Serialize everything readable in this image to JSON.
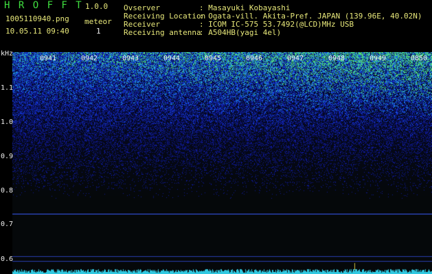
{
  "app": {
    "title": "H R O F F T",
    "version": "1.0.0",
    "filename": "1005110940.png",
    "datetime": "10.05.11 09:40",
    "meteor_label": "meteor",
    "meteor_count": "1"
  },
  "info": {
    "observer_label": "Ovserver",
    "observer_value": ": Masayuki Kobayashi",
    "location_label": "Receiving Location",
    "location_value": ": Ogata-vill. Akita-Pref. JAPAN (139.96E, 40.02N)",
    "receiver_label": "Receiver",
    "receiver_value": ": ICOM IC-575 53.7492(@LCD)MHz USB",
    "antenna_label": "Receiving antenna",
    "antenna_value": ": A504HB(yagi 4el)"
  },
  "axis": {
    "unit": "kHz",
    "y_labels": [
      "1.1",
      "1.0",
      "0.9",
      "0.8",
      "0.7",
      "0.6"
    ],
    "x_labels": [
      "0941",
      "0942",
      "0943",
      "0944",
      "0945",
      "0946",
      "0947",
      "0948",
      "0949",
      "0850"
    ]
  },
  "colors": {
    "header_text": "#e8e87a",
    "accent_green": "#40e040",
    "signal_line": "#3a5cff"
  }
}
